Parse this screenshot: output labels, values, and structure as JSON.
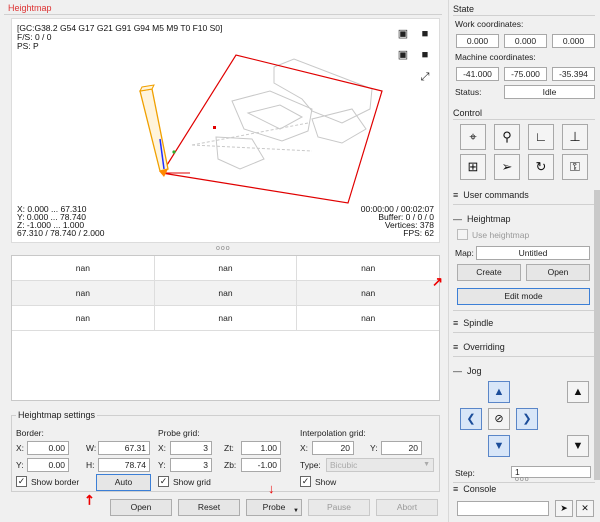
{
  "heightmap": {
    "title": "Heightmap",
    "gcode_state": "[GC:G38.2 G54 G17 G21 G91 G94 M5 M9 T0 F10 S0]",
    "fs": "F/S: 0 / 0",
    "ps": "PS: P",
    "coords_x": "X: 0.000 ... 67.310",
    "coords_y": "Y: 0.000 ... 78.740",
    "coords_z": "Z: -1.000 ... 1.000",
    "coords_size": "67.310 / 78.740 / 2.000",
    "time": "00:00:00 / 00:02:07",
    "buffer": "Buffer: 0 / 0 / 0",
    "vertices": "Vertices: 378",
    "fps": "FPS: 62",
    "splitter": "ooo"
  },
  "grid": {
    "rows": [
      [
        "nan",
        "nan",
        "nan"
      ],
      [
        "nan",
        "nan",
        "nan"
      ],
      [
        "nan",
        "nan",
        "nan"
      ]
    ]
  },
  "settings": {
    "title": "Heightmap settings",
    "border_label": "Border:",
    "probe_grid_label": "Probe grid:",
    "interp_label": "Interpolation grid:",
    "x": "X:",
    "y": "Y:",
    "w": "W:",
    "h": "H:",
    "zt": "Zt:",
    "zb": "Zb:",
    "type": "Type:",
    "border_x": "0.00",
    "border_y": "0.00",
    "border_w": "67.31",
    "border_h": "78.74",
    "probe_x": "3",
    "probe_y": "3",
    "probe_zt": "1.00",
    "probe_zb": "-1.00",
    "interp_x": "20",
    "interp_y": "20",
    "interp_type": "Bicubic",
    "show_border": "Show border",
    "auto": "Auto",
    "show_grid": "Show grid",
    "show": "Show",
    "check_mark": "✓"
  },
  "buttons": {
    "open": "Open",
    "reset": "Reset",
    "probe": "Probe",
    "pause": "Pause",
    "abort": "Abort"
  },
  "state": {
    "title": "State",
    "work_label": "Work coordinates:",
    "work": [
      "0.000",
      "0.000",
      "0.000"
    ],
    "machine_label": "Machine coordinates:",
    "machine": [
      "-41.000",
      "-75.000",
      "-35.394"
    ],
    "status_label": "Status:",
    "status": "Idle"
  },
  "control": {
    "title": "Control"
  },
  "user_commands": {
    "title": "User commands"
  },
  "heightmap_panel": {
    "title": "Heightmap",
    "use_heightmap": "Use heightmap",
    "map_label": "Map:",
    "map_value": "Untitled",
    "create": "Create",
    "open": "Open",
    "edit_mode": "Edit mode"
  },
  "spindle": {
    "title": "Spindle"
  },
  "overriding": {
    "title": "Overriding"
  },
  "jog": {
    "title": "Jog",
    "step_label": "Step:",
    "step_value": "1"
  },
  "console": {
    "title": "Console"
  },
  "colors": {
    "accent": "#d33333",
    "focus": "#3c7fd6",
    "jog_blue": "#1b4d9a"
  }
}
